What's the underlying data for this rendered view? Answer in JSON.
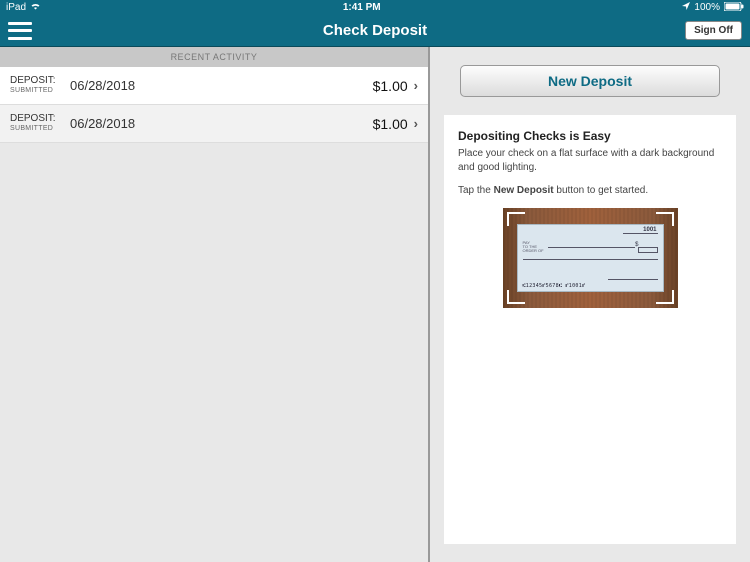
{
  "statusBar": {
    "device": "iPad",
    "time": "1:41 PM",
    "battery": "100%"
  },
  "nav": {
    "title": "Check Deposit",
    "signOff": "Sign Off"
  },
  "recentActivity": {
    "header": "RECENT ACTIVITY",
    "rows": [
      {
        "label": "DEPOSIT:",
        "status": "SUBMITTED",
        "date": "06/28/2018",
        "amount": "$1.00"
      },
      {
        "label": "DEPOSIT:",
        "status": "SUBMITTED",
        "date": "06/28/2018",
        "amount": "$1.00"
      }
    ]
  },
  "rightPane": {
    "newDeposit": "New Deposit",
    "info": {
      "title": "Depositing Checks is Easy",
      "line1": "Place your check on a flat surface with a dark background and good lighting.",
      "line2a": "Tap the ",
      "line2bold": "New Deposit",
      "line2b": " button to get started."
    },
    "check": {
      "number": "1001",
      "payTo": "PAY\nTO THE\nORDER OF",
      "micr": "⑆12345⑈5678⑆    ⑈1001⑈"
    }
  }
}
